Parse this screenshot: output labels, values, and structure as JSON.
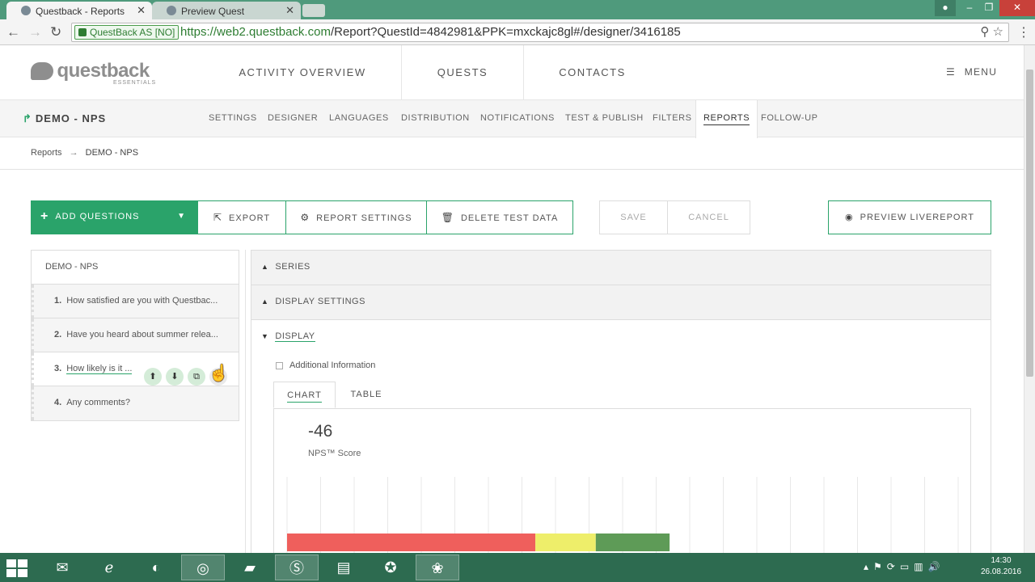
{
  "browser": {
    "tabs": [
      {
        "label": "Questback - Reports",
        "active": true
      },
      {
        "label": "Preview Quest",
        "active": false
      }
    ],
    "security_label": "QuestBack AS [NO]",
    "url_scheme_host": "https://web2.questback.com",
    "url_path": "/Report?QuestId=4842981&PPK=mxckajc8gl#/designer/3416185"
  },
  "header": {
    "logo_text": "questback",
    "logo_sub": "ESSENTIALS",
    "nav": [
      "ACTIVITY OVERVIEW",
      "QUESTS",
      "CONTACTS"
    ],
    "menu_label": "MENU"
  },
  "subnav": {
    "survey_title": "DEMO - NPS",
    "tabs": [
      "SETTINGS",
      "DESIGNER",
      "LANGUAGES",
      "DISTRIBUTION",
      "NOTIFICATIONS",
      "TEST & PUBLISH",
      "FILTERS",
      "REPORTS",
      "FOLLOW-UP"
    ],
    "active_tab": "REPORTS"
  },
  "breadcrumb": {
    "root": "Reports",
    "arrow": "→",
    "current": "DEMO - NPS"
  },
  "toolbar": {
    "add_questions": "ADD QUESTIONS",
    "export": "EXPORT",
    "report_settings": "REPORT SETTINGS",
    "delete_test_data": "DELETE TEST DATA",
    "save": "SAVE",
    "cancel": "CANCEL",
    "preview_livereport": "PREVIEW LIVEREPORT"
  },
  "questions": {
    "header": "DEMO - NPS",
    "items": [
      {
        "num": "1.",
        "text": "How satisfied are you with Questbac..."
      },
      {
        "num": "2.",
        "text": "Have you heard about summer relea..."
      },
      {
        "num": "3.",
        "text": "How likely is it ..."
      },
      {
        "num": "4.",
        "text": "Any comments?"
      }
    ]
  },
  "panel": {
    "series": "SERIES",
    "display_settings": "DISPLAY SETTINGS",
    "display": "DISPLAY",
    "additional_info": "Additional Information",
    "tab_chart": "CHART",
    "tab_table": "TABLE",
    "score": "-46",
    "score_label": "NPS™ Score"
  },
  "chart_data": {
    "type": "bar",
    "orientation": "horizontal-stacked",
    "segments": [
      {
        "name": "",
        "color": "#ef5f5c",
        "share": 0.37
      },
      {
        "name": "",
        "color": "#eeee6a",
        "share": 0.09
      },
      {
        "name": "",
        "color": "#5e9b57",
        "share": 0.11
      }
    ],
    "grid": true
  },
  "taskbar": {
    "time": "14:30",
    "date": "26.08.2016"
  }
}
